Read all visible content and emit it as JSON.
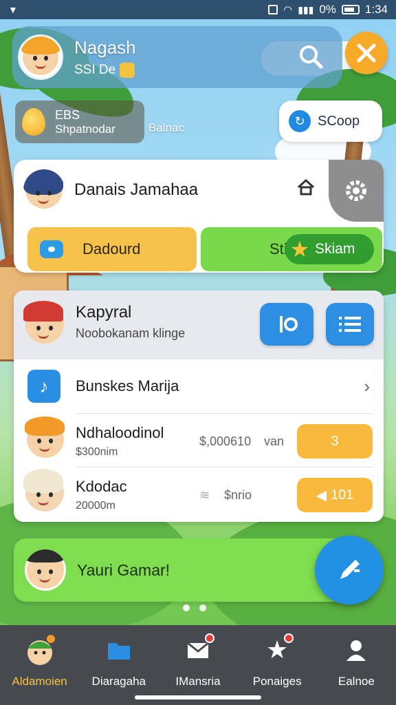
{
  "header": {
    "name": "Nagash",
    "sub": "SSI De"
  },
  "resource": {
    "top": "EBS",
    "bottom": "Shpatnodar",
    "balance_label": "Balnac"
  },
  "scoop_button": {
    "label": "SCoop"
  },
  "profile": {
    "name": "Danais Jamahaa",
    "primary_button": "Dadourd",
    "secondary_prefix": "Sti",
    "secondary_button": "Skiam"
  },
  "list": {
    "header_title": "Kapyral",
    "header_sub": "Noobokanam klinge",
    "rows": [
      {
        "title": "Bunskes Marija"
      },
      {
        "title": "Ndhaloodinol",
        "sub": "$300nim",
        "mid_value": "$,000610",
        "mid_tag": "van",
        "button": "3"
      },
      {
        "title": "Kdodac",
        "sub": "20000m",
        "mid_value": "$nrio",
        "button": "101"
      }
    ]
  },
  "banner": {
    "text": "Yauri Gamar!"
  },
  "nav": [
    {
      "label": "Aldamoien",
      "active": true
    },
    {
      "label": "Diaragaha"
    },
    {
      "label": "IMansria"
    },
    {
      "label": "Ponaiges"
    },
    {
      "label": "Ealnoe"
    }
  ],
  "status": {
    "battery_text": "0%",
    "time": "1:34"
  },
  "colors": {
    "accent_blue": "#2c8fe2",
    "accent_orange": "#f7a928",
    "accent_green": "#79d94b",
    "nav_bg": "#464a50"
  }
}
